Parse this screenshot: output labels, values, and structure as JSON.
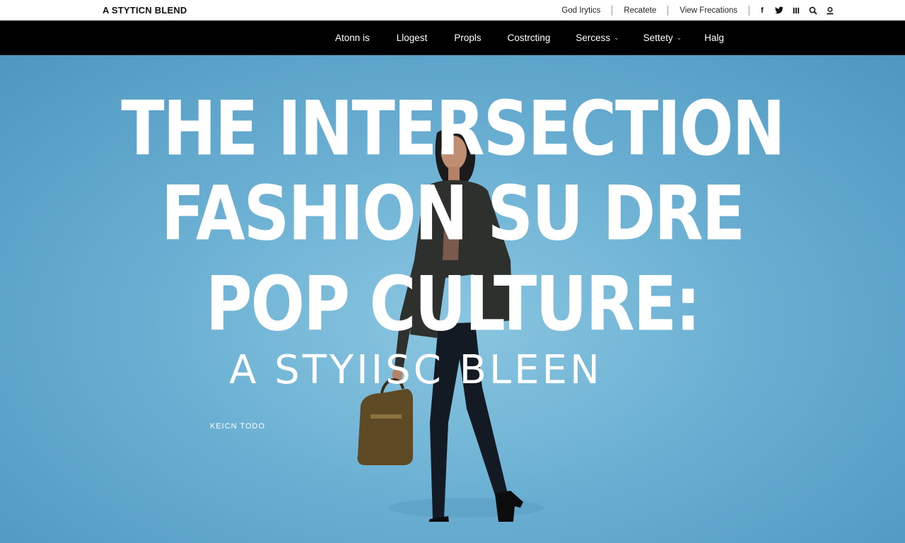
{
  "header": {
    "logo": "A STYTICN BLEND",
    "utility_links": [
      "God Irytics",
      "Recatete",
      "View Frecations"
    ],
    "social_icons": [
      "facebook-icon",
      "twitter-icon",
      "instagram-icon",
      "search-icon",
      "account-icon"
    ]
  },
  "nav": {
    "items": [
      {
        "label": "Atonn is",
        "dropdown": false
      },
      {
        "label": "Llogest",
        "dropdown": false
      },
      {
        "label": "Propls",
        "dropdown": false
      },
      {
        "label": "Costrcting",
        "dropdown": false
      },
      {
        "label": "Sercess",
        "dropdown": true
      },
      {
        "label": "Settety",
        "dropdown": true
      },
      {
        "label": "Halg",
        "dropdown": false
      }
    ]
  },
  "hero": {
    "line1": "THE INTERSECTION",
    "line2": "FASHION SU DRE",
    "line3": "POP  CULTURE:",
    "line4": "A  STYIISC  BLEEN",
    "kicker": "KEICN TODO"
  },
  "colors": {
    "topbar_bg": "#ffffff",
    "navbar_bg": "#000000",
    "hero_bg": "#6fb3d4",
    "hero_text": "#ffffff"
  }
}
